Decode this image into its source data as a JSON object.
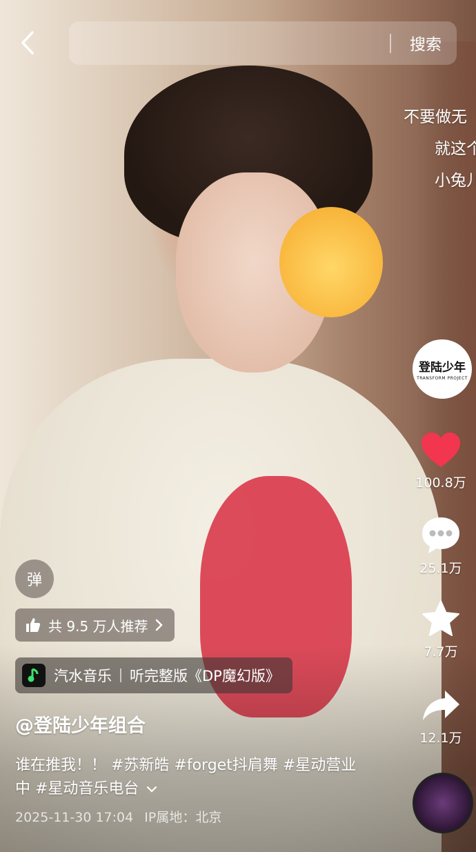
{
  "top": {
    "search_button": "搜索"
  },
  "danmaku": [
    "不要做无",
    "就这个",
    "小兔儿"
  ],
  "author_avatar": {
    "logo_text": "登陆少年",
    "logo_sub": "TRANSFORM PROJECT"
  },
  "actions": {
    "likes": "100.8万",
    "comments": "25.1万",
    "favorites": "7.7万",
    "shares": "12.1万",
    "like_color": "#f2364f"
  },
  "overlay": {
    "danmu_toggle": "弹",
    "recommend_text": "共 9.5 万人推荐",
    "music_app": "汽水音乐",
    "music_cta": "听完整版《DP魔幻版》"
  },
  "post": {
    "author": "@登陆少年组合",
    "description": "谁在推我！！ #苏新皓 #forget抖肩舞 #星动营业中 #星动音乐电台",
    "date": "2025-11-30 17:04",
    "ip": "IP属地：北京"
  }
}
